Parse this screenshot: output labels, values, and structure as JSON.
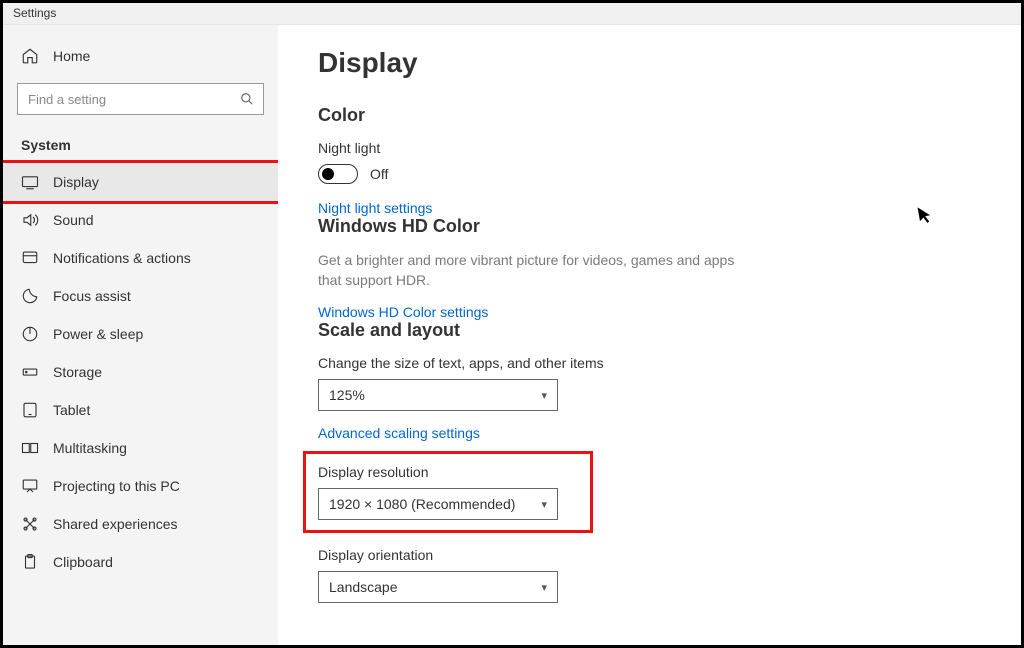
{
  "window": {
    "title": "Settings"
  },
  "sidebar": {
    "home": "Home",
    "search_placeholder": "Find a setting",
    "group": "System",
    "items": [
      {
        "label": "Display"
      },
      {
        "label": "Sound"
      },
      {
        "label": "Notifications & actions"
      },
      {
        "label": "Focus assist"
      },
      {
        "label": "Power & sleep"
      },
      {
        "label": "Storage"
      },
      {
        "label": "Tablet"
      },
      {
        "label": "Multitasking"
      },
      {
        "label": "Projecting to this PC"
      },
      {
        "label": "Shared experiences"
      },
      {
        "label": "Clipboard"
      }
    ]
  },
  "page": {
    "title": "Display",
    "color": {
      "heading": "Color",
      "night_light_label": "Night light",
      "night_light_state": "Off",
      "night_light_link": "Night light settings"
    },
    "hd": {
      "heading": "Windows HD Color",
      "desc": "Get a brighter and more vibrant picture for videos, games and apps that support HDR.",
      "link": "Windows HD Color settings"
    },
    "scale": {
      "heading": "Scale and layout",
      "size_label": "Change the size of text, apps, and other items",
      "size_value": "125%",
      "adv_link": "Advanced scaling settings",
      "res_label": "Display resolution",
      "res_value": "1920 × 1080 (Recommended)",
      "orient_label": "Display orientation",
      "orient_value": "Landscape"
    }
  }
}
